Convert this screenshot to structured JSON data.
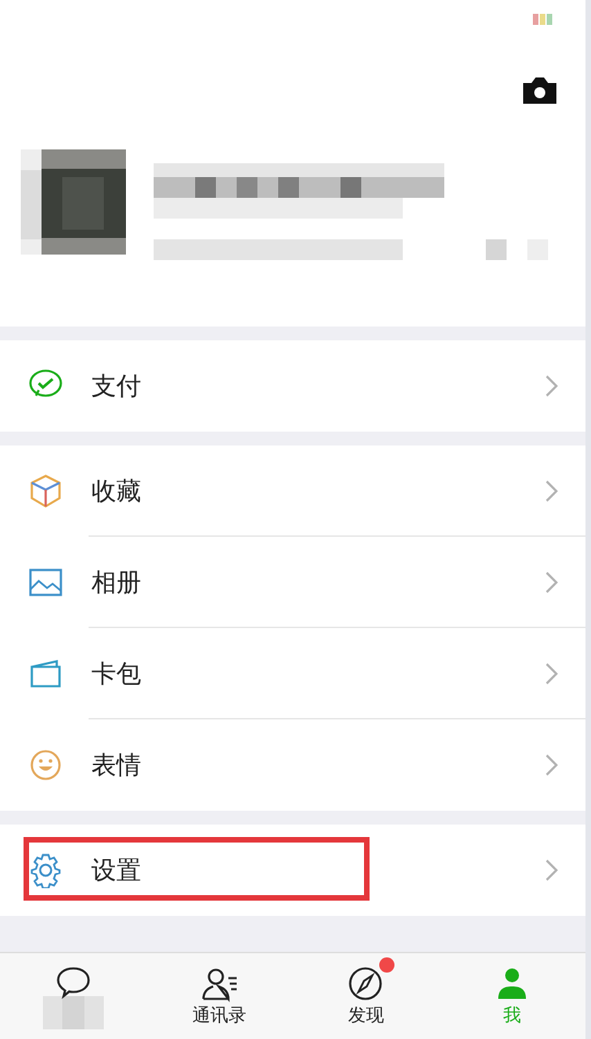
{
  "groups": [
    [
      {
        "label": "支付"
      }
    ],
    [
      {
        "label": "收藏"
      },
      {
        "label": "相册"
      },
      {
        "label": "卡包"
      },
      {
        "label": "表情"
      }
    ],
    [
      {
        "label": "设置",
        "highlighted": true
      }
    ]
  ],
  "tabs": [
    {
      "selected": false,
      "dot": false
    },
    {
      "label": "通讯录",
      "selected": false,
      "dot": false
    },
    {
      "label": "发现",
      "selected": false,
      "dot": true
    },
    {
      "label": "我",
      "selected": true,
      "dot": false
    }
  ]
}
